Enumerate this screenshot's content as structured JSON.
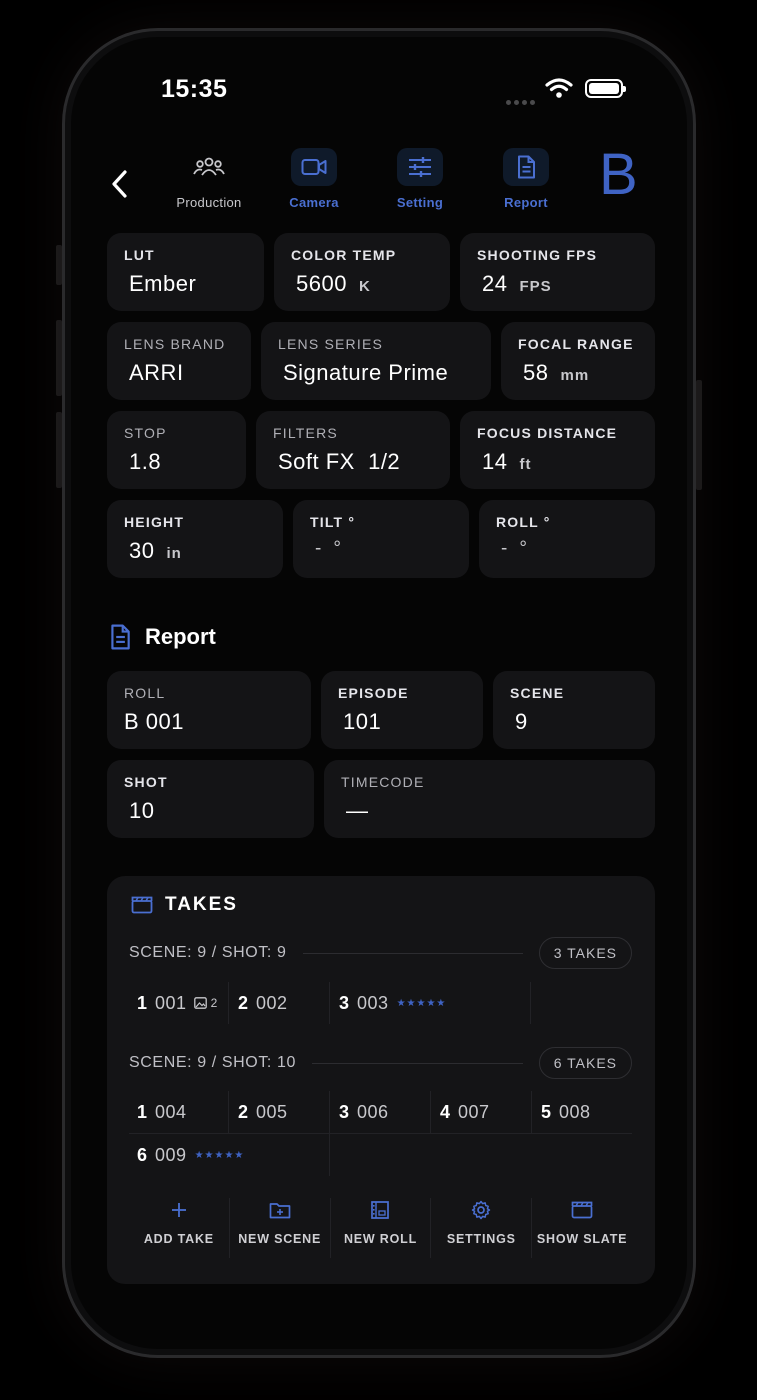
{
  "status_bar": {
    "time": "15:35"
  },
  "nav": {
    "items": [
      {
        "label": "Production",
        "icon": "people-icon",
        "active": false
      },
      {
        "label": "Camera",
        "icon": "video-camera-icon",
        "active": true
      },
      {
        "label": "Setting",
        "icon": "sliders-icon",
        "active": true
      },
      {
        "label": "Report",
        "icon": "document-icon",
        "active": true
      }
    ],
    "camera_letter": "B",
    "accent": "#3f63c4"
  },
  "camera": {
    "lut": {
      "label": "LUT",
      "value": "Ember"
    },
    "color_temp": {
      "label": "COLOR TEMP",
      "value": "5600",
      "unit": "K"
    },
    "shooting_fps": {
      "label": "SHOOTING FPS",
      "value": "24",
      "unit": "FPS"
    },
    "lens_brand": {
      "label": "LENS BRAND",
      "value": "ARRI"
    },
    "lens_series": {
      "label": "LENS SERIES",
      "value": "Signature Prime"
    },
    "focal_range": {
      "label": "FOCAL RANGE",
      "value": "58",
      "unit": "mm"
    },
    "stop": {
      "label": "STOP",
      "value": "1.8"
    },
    "filters": {
      "label": "FILTERS",
      "value": "Soft FX  1/2"
    },
    "focus_distance": {
      "label": "FOCUS DISTANCE",
      "value": "14",
      "unit": "ft"
    },
    "height": {
      "label": "HEIGHT",
      "value": "30",
      "unit": "in"
    },
    "tilt": {
      "label": "TILT °",
      "value": "-  °"
    },
    "roll_deg": {
      "label": "ROLL °",
      "value": "-  °"
    }
  },
  "report": {
    "title": "Report",
    "roll": {
      "label": "ROLL",
      "value": "B 001"
    },
    "episode": {
      "label": "EPISODE",
      "value": "101"
    },
    "scene": {
      "label": "SCENE",
      "value": "9"
    },
    "shot": {
      "label": "SHOT",
      "value": "10"
    },
    "timecode": {
      "label": "TIMECODE",
      "value": "—"
    }
  },
  "takes": {
    "title": "TAKES",
    "groups": [
      {
        "label": "SCENE: 9 / SHOT: 9",
        "count": "3 TAKES",
        "items": [
          {
            "num": "1",
            "code": "001",
            "images": "2",
            "rating": 0
          },
          {
            "num": "2",
            "code": "002",
            "rating": 0
          },
          {
            "num": "3",
            "code": "003",
            "rating": 5,
            "stars": "★★★★★"
          }
        ]
      },
      {
        "label": "SCENE: 9 / SHOT: 10",
        "count": "6 TAKES",
        "items": [
          {
            "num": "1",
            "code": "004",
            "rating": 0
          },
          {
            "num": "2",
            "code": "005",
            "rating": 0
          },
          {
            "num": "3",
            "code": "006",
            "rating": 0
          },
          {
            "num": "4",
            "code": "007",
            "rating": 0
          },
          {
            "num": "5",
            "code": "008",
            "rating": 0
          },
          {
            "num": "6",
            "code": "009",
            "rating": 5,
            "stars": "★★★★★"
          }
        ]
      }
    ],
    "actions": [
      {
        "label": "ADD TAKE",
        "icon": "plus-icon"
      },
      {
        "label": "NEW SCENE",
        "icon": "folder-plus-icon"
      },
      {
        "label": "NEW ROLL",
        "icon": "film-roll-icon"
      },
      {
        "label": "SETTINGS",
        "icon": "gear-icon"
      },
      {
        "label": "SHOW SLATE",
        "icon": "clapper-icon"
      }
    ]
  }
}
